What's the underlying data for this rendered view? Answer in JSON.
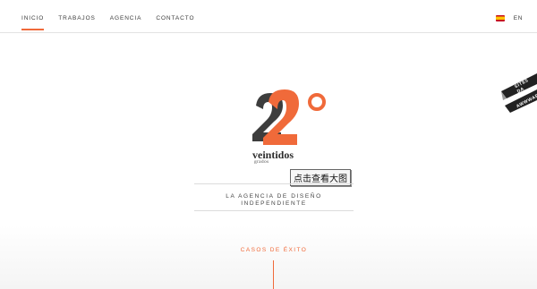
{
  "nav": {
    "items": [
      {
        "label": "INICIO",
        "active": true
      },
      {
        "label": "TRABAJOS",
        "active": false
      },
      {
        "label": "AGENCIA",
        "active": false
      },
      {
        "label": "CONTACTO",
        "active": false
      }
    ],
    "language": {
      "current": "EN",
      "flag": "spain-flag-icon"
    }
  },
  "brand": {
    "name": "veintidos",
    "subname": "grados",
    "logo_icon": "two-degrees-logo-icon"
  },
  "overlay": {
    "zoom_hint": "点击查看大图"
  },
  "hero": {
    "tagline": "LA AGENCIA DE DISEÑO INDEPENDIENTE"
  },
  "section": {
    "title": "CASOS DE ÉXITO"
  },
  "ribbon": {
    "line1": "SITE5 DA",
    "line2": "AWWWAR"
  },
  "colors": {
    "accent": "#f06a3a",
    "dark": "#3d3d3d"
  }
}
